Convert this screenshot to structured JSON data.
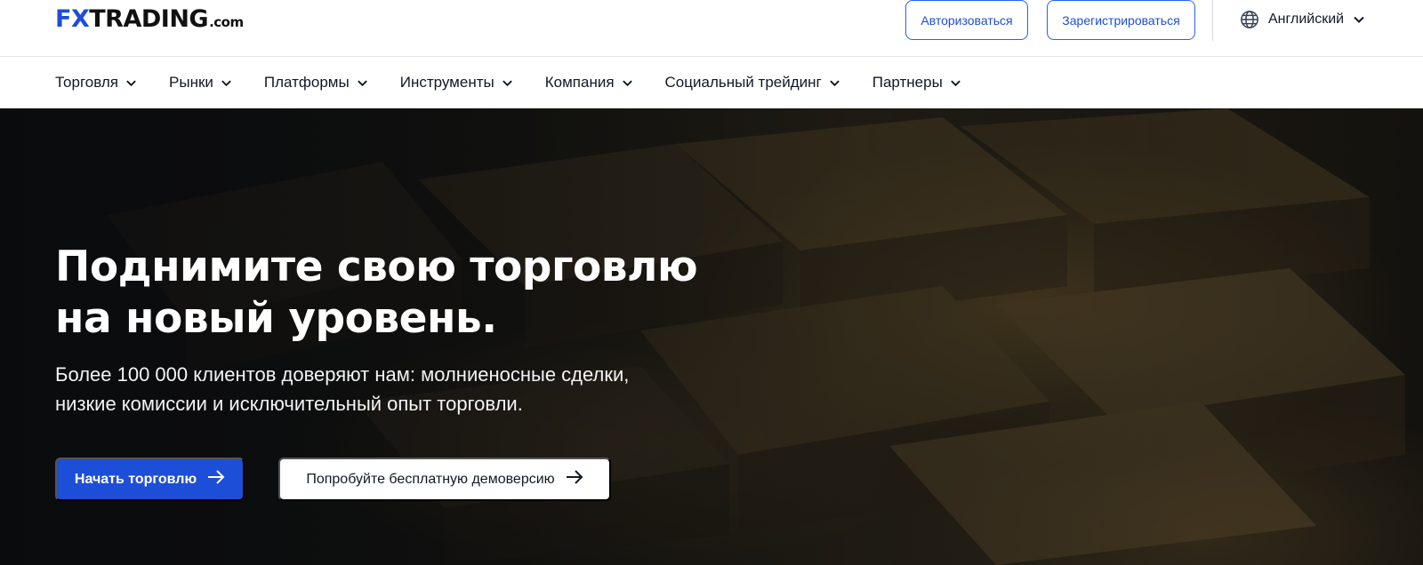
{
  "header": {
    "logo": {
      "fx": "FX",
      "trading": "TRADING",
      "com": ".com"
    },
    "login_label": "Авторизоваться",
    "register_label": "Зарегистрироваться",
    "language_label": "Английский"
  },
  "nav": {
    "items": [
      {
        "label": "Торговля"
      },
      {
        "label": "Рынки"
      },
      {
        "label": "Платформы"
      },
      {
        "label": "Инструменты"
      },
      {
        "label": "Компания"
      },
      {
        "label": "Социальный трейдинг"
      },
      {
        "label": "Партнеры"
      }
    ]
  },
  "hero": {
    "title_line1": "Поднимите свою торговлю",
    "title_line2": "на новый уровень.",
    "subtitle_line1": "Более 100 000 клиентов доверяют нам: молниеносные сделки,",
    "subtitle_line2": "низкие комиссии и исключительный опыт торговли.",
    "primary_cta": "Начать торговлю",
    "secondary_cta": "Попробуйте бесплатную демоверсию"
  },
  "colors": {
    "accent": "#1d4ed8",
    "hero_dark": "#16150f",
    "gold": "#8a6d3b"
  },
  "icons": {
    "language": "globe-icon",
    "dropdown": "chevron-down-icon",
    "cta": "arrow-right-icon"
  }
}
